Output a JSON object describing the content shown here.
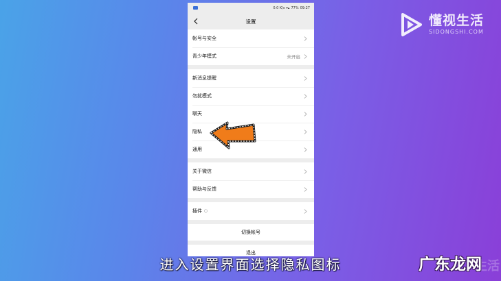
{
  "statusbar": {
    "network_speed": "0.0 K/s",
    "battery": "77%",
    "time": "09:27"
  },
  "navbar": {
    "title": "设置"
  },
  "groups": [
    {
      "rows": [
        {
          "label": "帐号与安全",
          "value": ""
        },
        {
          "label": "青少年模式",
          "value": "未开启"
        }
      ]
    },
    {
      "rows": [
        {
          "label": "新消息提醒",
          "value": ""
        },
        {
          "label": "勿扰模式",
          "value": ""
        },
        {
          "label": "聊天",
          "value": ""
        },
        {
          "label": "隐私",
          "value": ""
        },
        {
          "label": "通用",
          "value": ""
        }
      ]
    },
    {
      "rows": [
        {
          "label": "关于微信",
          "value": ""
        },
        {
          "label": "帮助与反馈",
          "value": ""
        }
      ]
    },
    {
      "rows": [
        {
          "label": "插件",
          "value": ""
        }
      ]
    }
  ],
  "switch_account": "切换帐号",
  "logout": "退出",
  "logo": {
    "title": "懂视生活",
    "subtitle": "SIDONGSHI.COM"
  },
  "caption": "进入设置界面选择隐私图标",
  "watermark": "广东龙网",
  "watermark_ghost": "生活",
  "colors": {
    "arrow_fill": "#f07c1a",
    "logo_accent": "#ffffff",
    "background_start": "#4aa3e8",
    "background_end": "#8a3fd8"
  }
}
